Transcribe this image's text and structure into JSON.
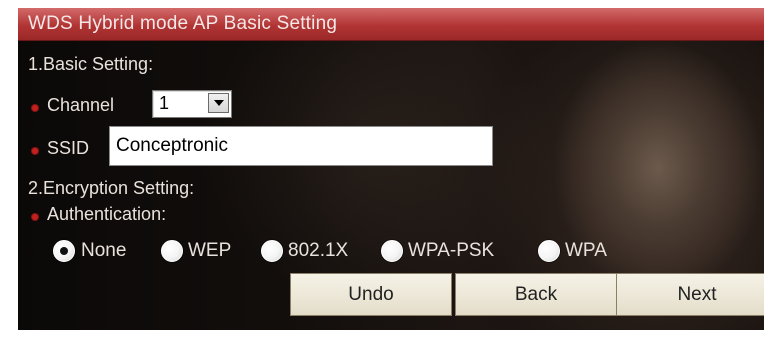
{
  "window": {
    "title": "WDS Hybrid mode AP Basic Setting"
  },
  "sections": {
    "basic": {
      "heading": "1.Basic Setting:",
      "channel_label": "Channel",
      "channel_value": "1",
      "ssid_label": "SSID",
      "ssid_value": "Conceptronic"
    },
    "encryption": {
      "heading": "2.Encryption Setting:",
      "authentication_label": "Authentication:",
      "options": [
        {
          "label": "None",
          "selected": true
        },
        {
          "label": "WEP",
          "selected": false
        },
        {
          "label": "802.1X",
          "selected": false
        },
        {
          "label": "WPA-PSK",
          "selected": false
        },
        {
          "label": "WPA",
          "selected": false
        }
      ]
    }
  },
  "buttons": {
    "undo": "Undo",
    "back": "Back",
    "next": "Next"
  },
  "colors": {
    "title_bar": "#b23434",
    "bullet": "#c31f1f",
    "text": "#e9e2dc",
    "button_bg": "#ece7d7"
  },
  "icons": {
    "bullet": "red-dot-icon",
    "dropdown": "chevron-down-icon"
  }
}
